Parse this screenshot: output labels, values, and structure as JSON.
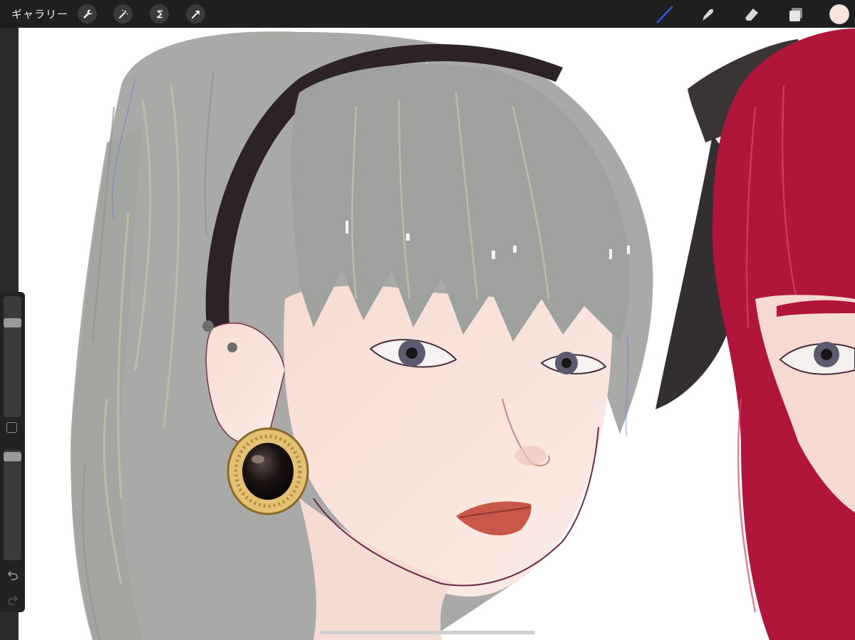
{
  "topbar": {
    "gallery_label": "ギャラリー",
    "left_tools": [
      {
        "name": "actions-wrench-icon"
      },
      {
        "name": "adjustments-wand-icon"
      },
      {
        "name": "selection-s-icon"
      },
      {
        "name": "transform-arrow-icon"
      }
    ],
    "right_tools": [
      {
        "name": "brush-icon",
        "active": true
      },
      {
        "name": "smudge-icon"
      },
      {
        "name": "eraser-icon"
      },
      {
        "name": "layers-icon"
      }
    ],
    "current_color": "#fbe4dd",
    "active_tool_color": "#2f5be0"
  },
  "sidebar": {
    "brush_size_level": 0.8,
    "opacity_level": 0.02
  },
  "colors": {
    "toolbar_bg": "#1f1f1f",
    "canvas_bg": "#ffffff",
    "hair_gray": "#a8aaa6",
    "hair_red": "#b0153a",
    "headband": "#2d2228",
    "skin": "#f8e2da"
  }
}
